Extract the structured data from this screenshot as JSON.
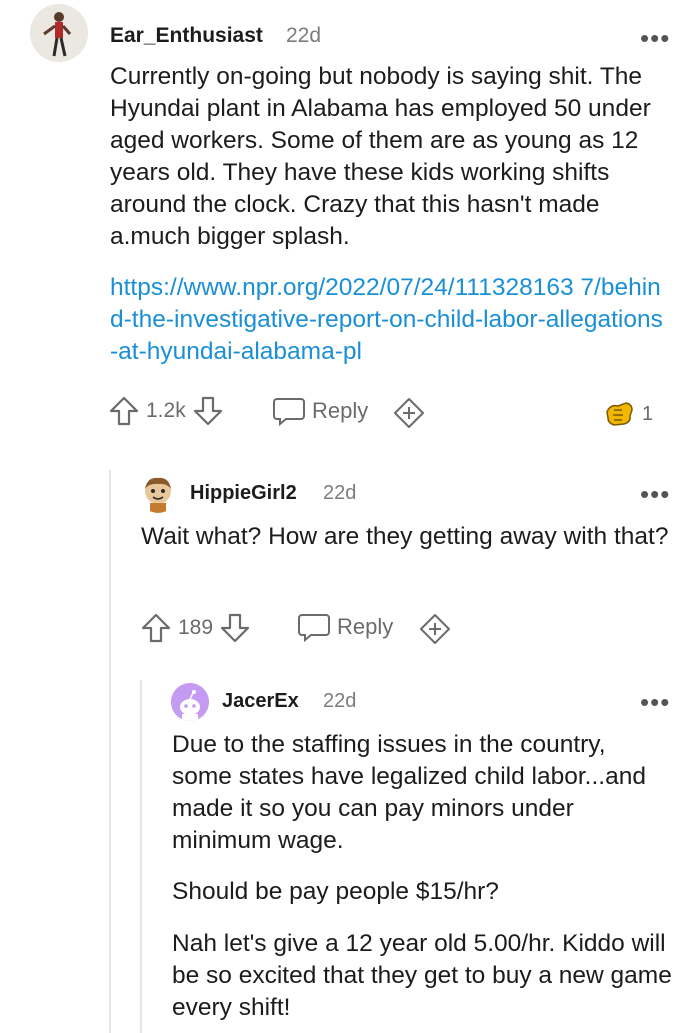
{
  "comments": [
    {
      "username": "Ear_Enthusiast",
      "time": "22d",
      "paragraphs": [
        "Currently on-going but nobody is saying shit. The Hyundai plant in Alabama has employed 50 under aged workers. Some of them are as young as 12 years old. They have these kids working shifts around the clock. Crazy that this hasn't made a.much bigger splash."
      ],
      "link": "https://www.npr.org/2022/07/24/111328163 7/behind-the-investigative-report-on-child-labor-allegations-at-hyundai-alabama-pl",
      "votes": "1.2k",
      "reply_label": "Reply",
      "award_count": "1"
    },
    {
      "username": "HippieGirl2",
      "time": "22d",
      "paragraphs": [
        "Wait what? How are they getting away with that?"
      ],
      "votes": "189",
      "reply_label": "Reply"
    },
    {
      "username": "JacerEx",
      "time": "22d",
      "paragraphs": [
        "Due to the staffing issues in the country, some states have legalized child labor...and made it so you can pay minors under minimum wage.",
        "Should be pay people $15/hr?",
        "Nah let's give a 12 year old 5.00/hr. Kiddo will be so excited that they get to buy a new game every shift!"
      ]
    }
  ],
  "colors": {
    "link": "#1a8fd6",
    "jacer_avatar_bg": "#c59af2",
    "award_gold": "#f2b705"
  },
  "icons": [
    "more-dots-icon",
    "upvote-icon",
    "downvote-icon",
    "reply-bubble-icon",
    "add-award-icon",
    "award-icon"
  ]
}
